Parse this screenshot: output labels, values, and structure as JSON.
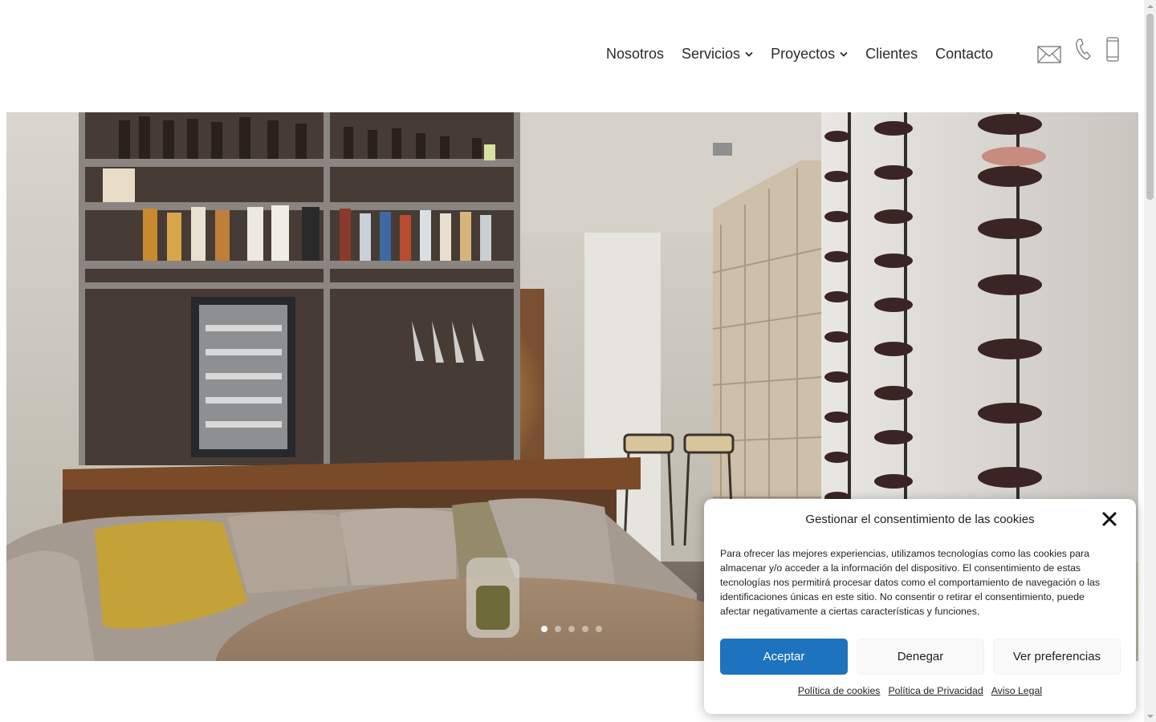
{
  "nav": {
    "items": [
      {
        "label": "Nosotros",
        "has_dropdown": false
      },
      {
        "label": "Servicios",
        "has_dropdown": true
      },
      {
        "label": "Proyectos",
        "has_dropdown": true
      },
      {
        "label": "Clientes",
        "has_dropdown": false
      },
      {
        "label": "Contacto",
        "has_dropdown": false
      }
    ],
    "icons": [
      "envelope-icon",
      "phone-icon",
      "mobile-icon"
    ]
  },
  "hero": {
    "slide_count": 5,
    "active_slide": 1
  },
  "cookie": {
    "title": "Gestionar el consentimiento de las cookies",
    "text": "Para ofrecer las mejores experiencias, utilizamos tecnologías como las cookies para almacenar y/o acceder a la información del dispositivo. El consentimiento de estas tecnologías nos permitirá procesar datos como el comportamiento de navegación o las identificaciones únicas en este sitio. No consentir o retirar el consentimiento, puede afectar negativamente a ciertas características y funciones.",
    "accept_label": "Aceptar",
    "deny_label": "Denegar",
    "prefs_label": "Ver preferencias",
    "links": {
      "cookies": "Política de cookies",
      "privacy": "Política de Privacidad",
      "legal": "Aviso Legal"
    }
  },
  "colors": {
    "accent": "#1e73be",
    "text": "#222222"
  }
}
